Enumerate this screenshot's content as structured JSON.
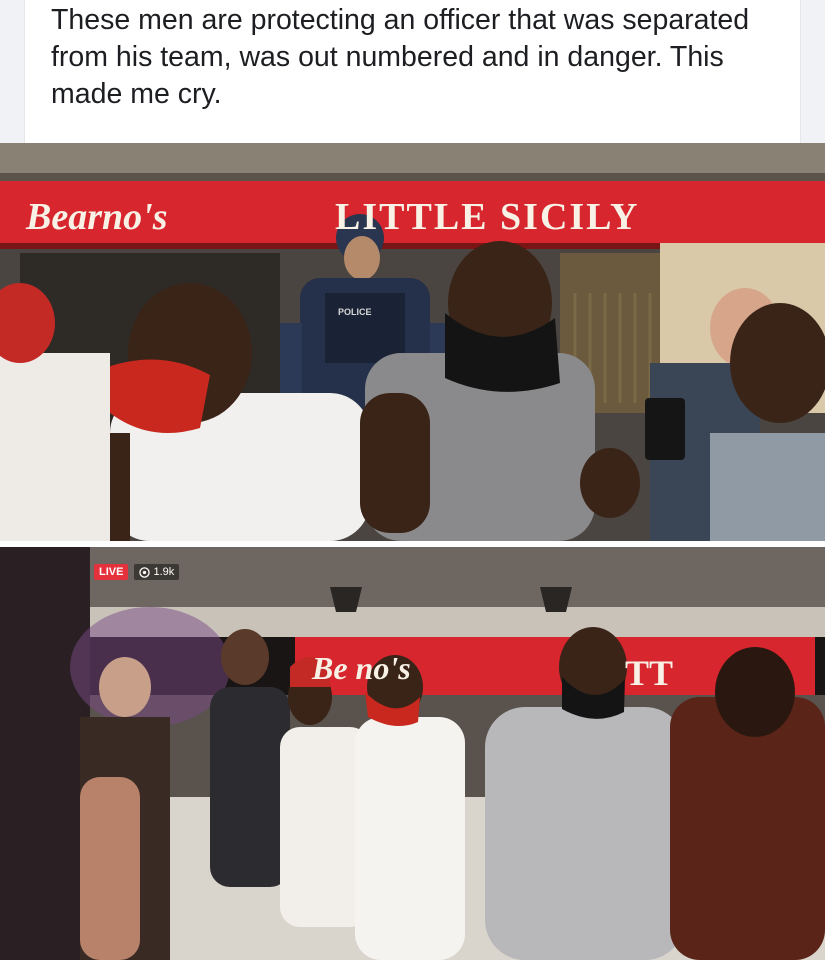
{
  "post": {
    "caption": "These men are protecting an officer that was separated from his team, was out numbered and in danger. This made me cry."
  },
  "photo_top": {
    "sign_brand": "Bearno's",
    "sign_name": "LITTLE SICILY",
    "vest_text": "POLICE"
  },
  "photo_bottom": {
    "live_label": "LIVE",
    "viewer_count": "1.9k",
    "sign_brand_partial": "Be    no's",
    "sign_name_partial": "TT"
  },
  "colors": {
    "sign_red": "#d8262e",
    "live_red": "#e4313b",
    "caption_text": "#1c1e21"
  }
}
